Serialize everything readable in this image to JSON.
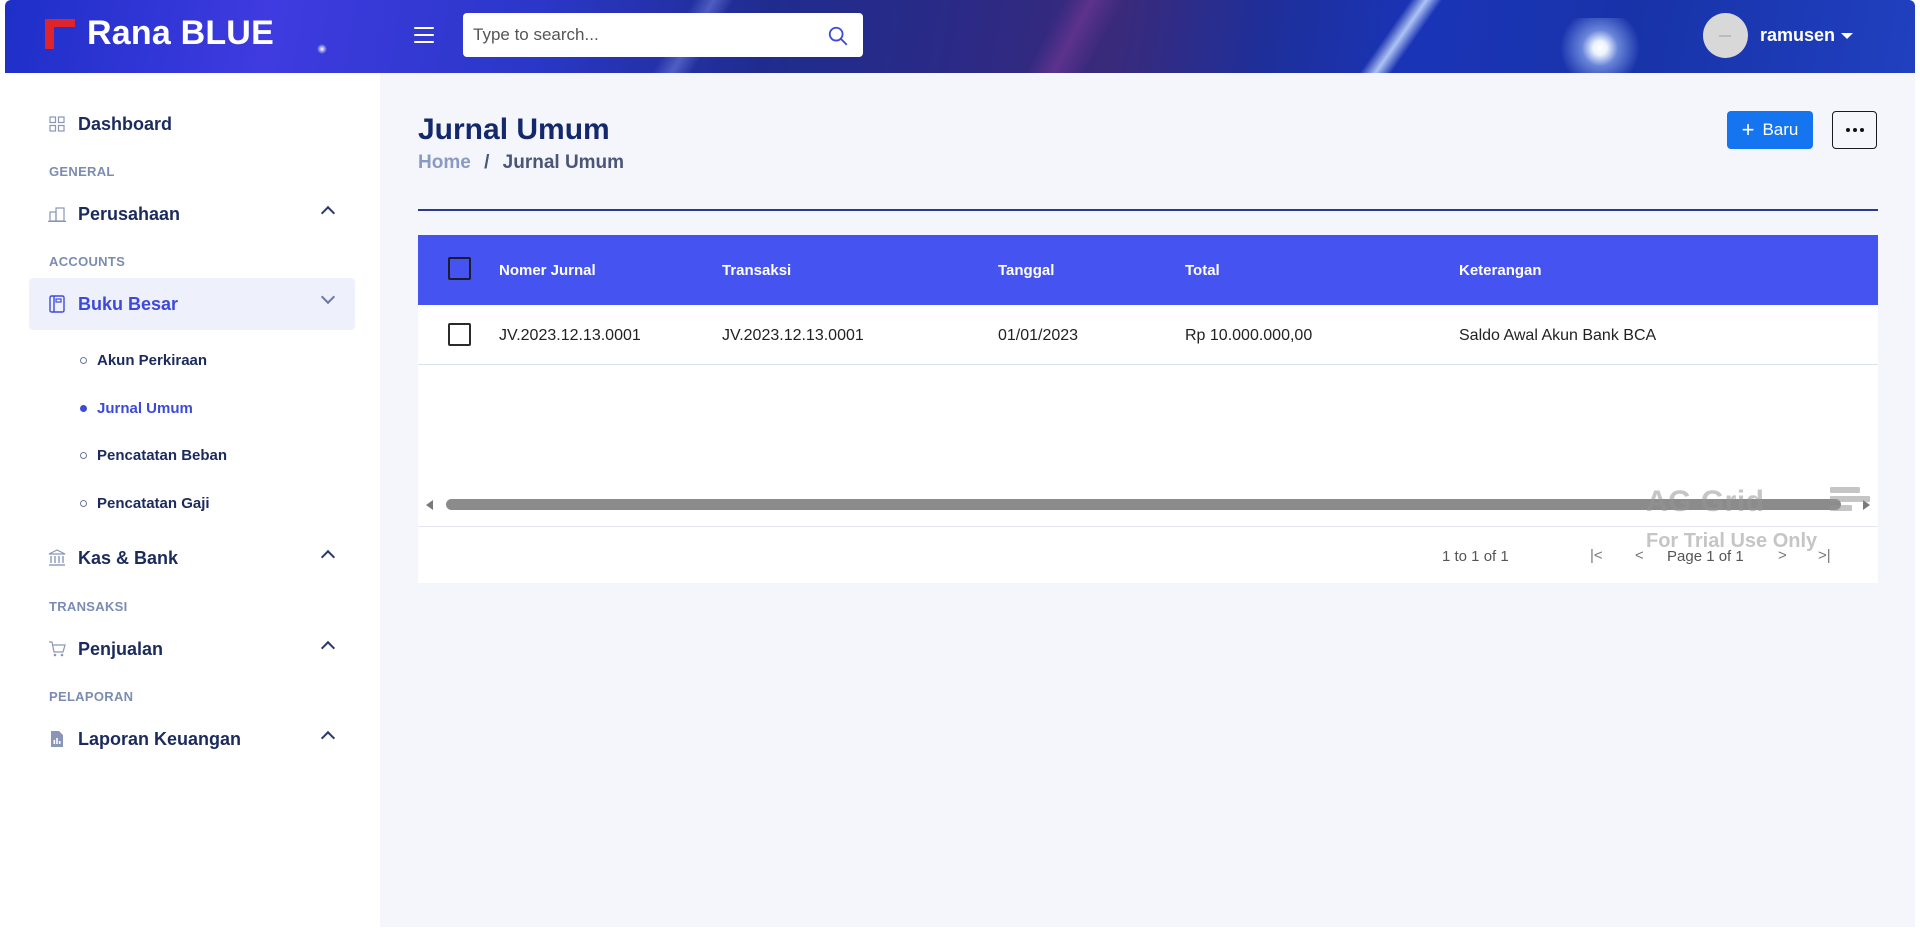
{
  "header": {
    "brand_name": "Rana BLUE",
    "search_placeholder": "Type to search...",
    "username": "ramusen"
  },
  "sidebar": {
    "dashboard_label": "Dashboard",
    "sections": {
      "general": "GENERAL",
      "accounts": "ACCOUNTS",
      "transaksi": "TRANSAKSI",
      "pelaporan": "PELAPORAN"
    },
    "items": {
      "perusahaan": "Perusahaan",
      "buku_besar": "Buku Besar",
      "kas_bank": "Kas & Bank",
      "penjualan": "Penjualan",
      "laporan_keuangan": "Laporan Keuangan"
    },
    "sub_items": [
      {
        "label": "Akun Perkiraan",
        "active": false
      },
      {
        "label": "Jurnal Umum",
        "active": true
      },
      {
        "label": "Pencatatan Beban",
        "active": false
      },
      {
        "label": "Pencatatan Gaji",
        "active": false
      }
    ]
  },
  "main": {
    "title": "Jurnal Umum",
    "breadcrumb": {
      "home": "Home",
      "separator": "/",
      "current": "Jurnal Umum"
    },
    "new_button_label": "Baru",
    "new_button_icon": "plus-icon",
    "more_button_icon": "more-horizontal-icon"
  },
  "grid": {
    "columns": [
      "Nomer Jurnal",
      "Transaksi",
      "Tanggal",
      "Total",
      "Keterangan"
    ],
    "rows": [
      [
        "JV.2023.12.13.0001",
        "JV.2023.12.13.0001",
        "01/01/2023",
        "Rp 10.000.000,00",
        "Saldo Awal Akun Bank BCA"
      ]
    ],
    "pager": {
      "rows_summary": "1 to 1 of 1",
      "page_summary": "Page 1 of 1"
    },
    "watermark": {
      "title": "AG Grid",
      "subtitle": "For Trial Use Only"
    }
  },
  "colors": {
    "accent": "#4553f0",
    "primary_button": "#1574f0",
    "active_menu_text": "#3d4ad9",
    "brand_mark": "#e0242b"
  }
}
